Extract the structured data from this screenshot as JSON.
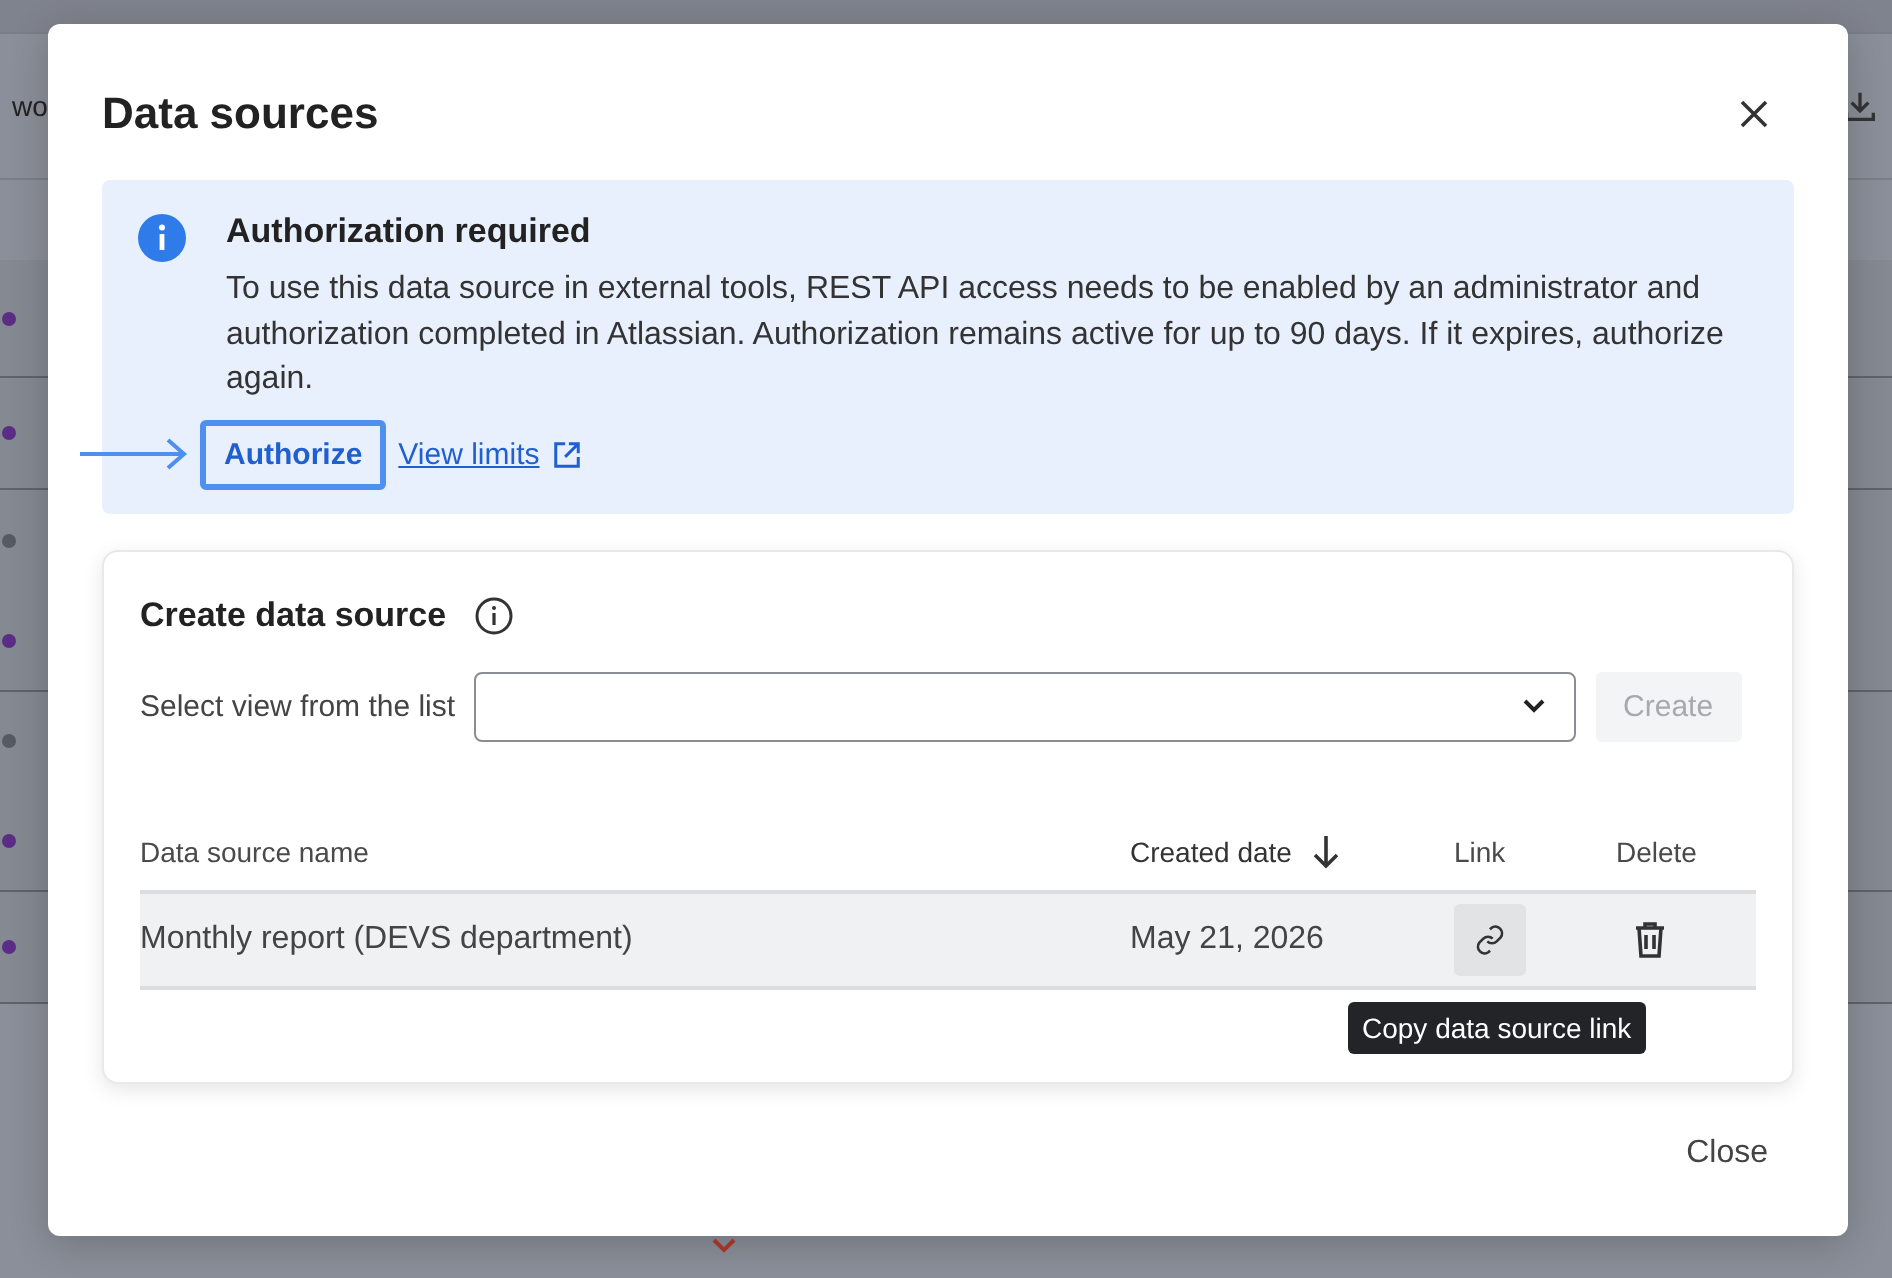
{
  "background": {
    "toolbar_text": "wo",
    "rows": [
      {
        "dots": [
          {
            "color": "#5b2d86"
          }
        ]
      },
      {
        "dots": [
          {
            "color": "#5b2d86"
          }
        ]
      },
      {
        "dots": [
          {
            "color": "#555a63"
          },
          {
            "color": "#5b2d86"
          }
        ]
      },
      {
        "dots": [
          {
            "color": "#555a63"
          },
          {
            "color": "#5b2d86"
          }
        ]
      },
      {
        "dots": [
          {
            "color": "#5b2d86"
          }
        ]
      }
    ],
    "bottom_row": {
      "priority_icon": true
    }
  },
  "dialog": {
    "title": "Data sources",
    "alert": {
      "title": "Authorization required",
      "body": "To use this data source in external tools, REST API access needs to be enabled by an administrator and authorization completed in Atlassian. Authorization remains active for up to 90 days. If it expires, authorize again.",
      "authorize_button": "Authorize",
      "link": "View limits"
    },
    "create": {
      "title": "Create data source",
      "select_label": "Select view from the list",
      "create_button": {
        "label": "Create",
        "disabled": true
      },
      "columns": [
        {
          "label": "Data source name",
          "sorted": false
        },
        {
          "label": "Created date",
          "sorted": true
        },
        {
          "label": "Link",
          "sorted": false
        },
        {
          "label": "Delete",
          "sorted": false
        }
      ],
      "rows": [
        {
          "name": "Monthly report (DEVS department)",
          "created": "May 21, 2026"
        }
      ],
      "tooltip": "Copy data source link"
    },
    "close_button": "Close"
  }
}
